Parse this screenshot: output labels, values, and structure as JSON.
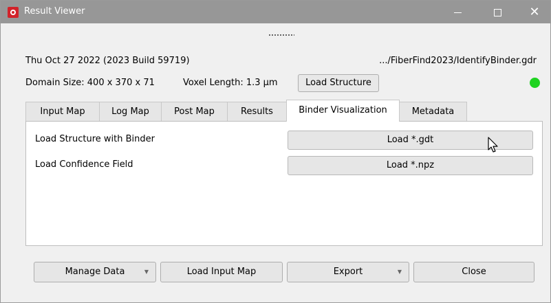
{
  "window": {
    "title": "Result Viewer",
    "controls": {
      "minimize": "—",
      "maximize": "□",
      "close": "✕"
    }
  },
  "info": {
    "date_build": "Thu Oct 27 2022 (2023 Build 59719)",
    "path": ".../FiberFind2023/IdentifyBinder.gdr",
    "domain_size": "Domain Size: 400 x 370 x 71",
    "voxel_length": "Voxel Length: 1.3 µm",
    "load_structure_label": "Load Structure",
    "status_color": "#1fd321"
  },
  "tabs": [
    {
      "label": "Input Map",
      "active": false
    },
    {
      "label": "Log Map",
      "active": false
    },
    {
      "label": "Post Map",
      "active": false
    },
    {
      "label": "Results",
      "active": false
    },
    {
      "label": "Binder Visualization",
      "active": true
    },
    {
      "label": "Metadata",
      "active": false
    }
  ],
  "panel": {
    "rows": [
      {
        "label": "Load Structure with Binder",
        "button": "Load *.gdt"
      },
      {
        "label": "Load Confidence Field",
        "button": "Load *.npz"
      }
    ]
  },
  "bottom": {
    "manage_data": "Manage Data",
    "load_input_map": "Load Input Map",
    "export": "Export",
    "close": "Close",
    "dropdown_arrow": "▼"
  }
}
